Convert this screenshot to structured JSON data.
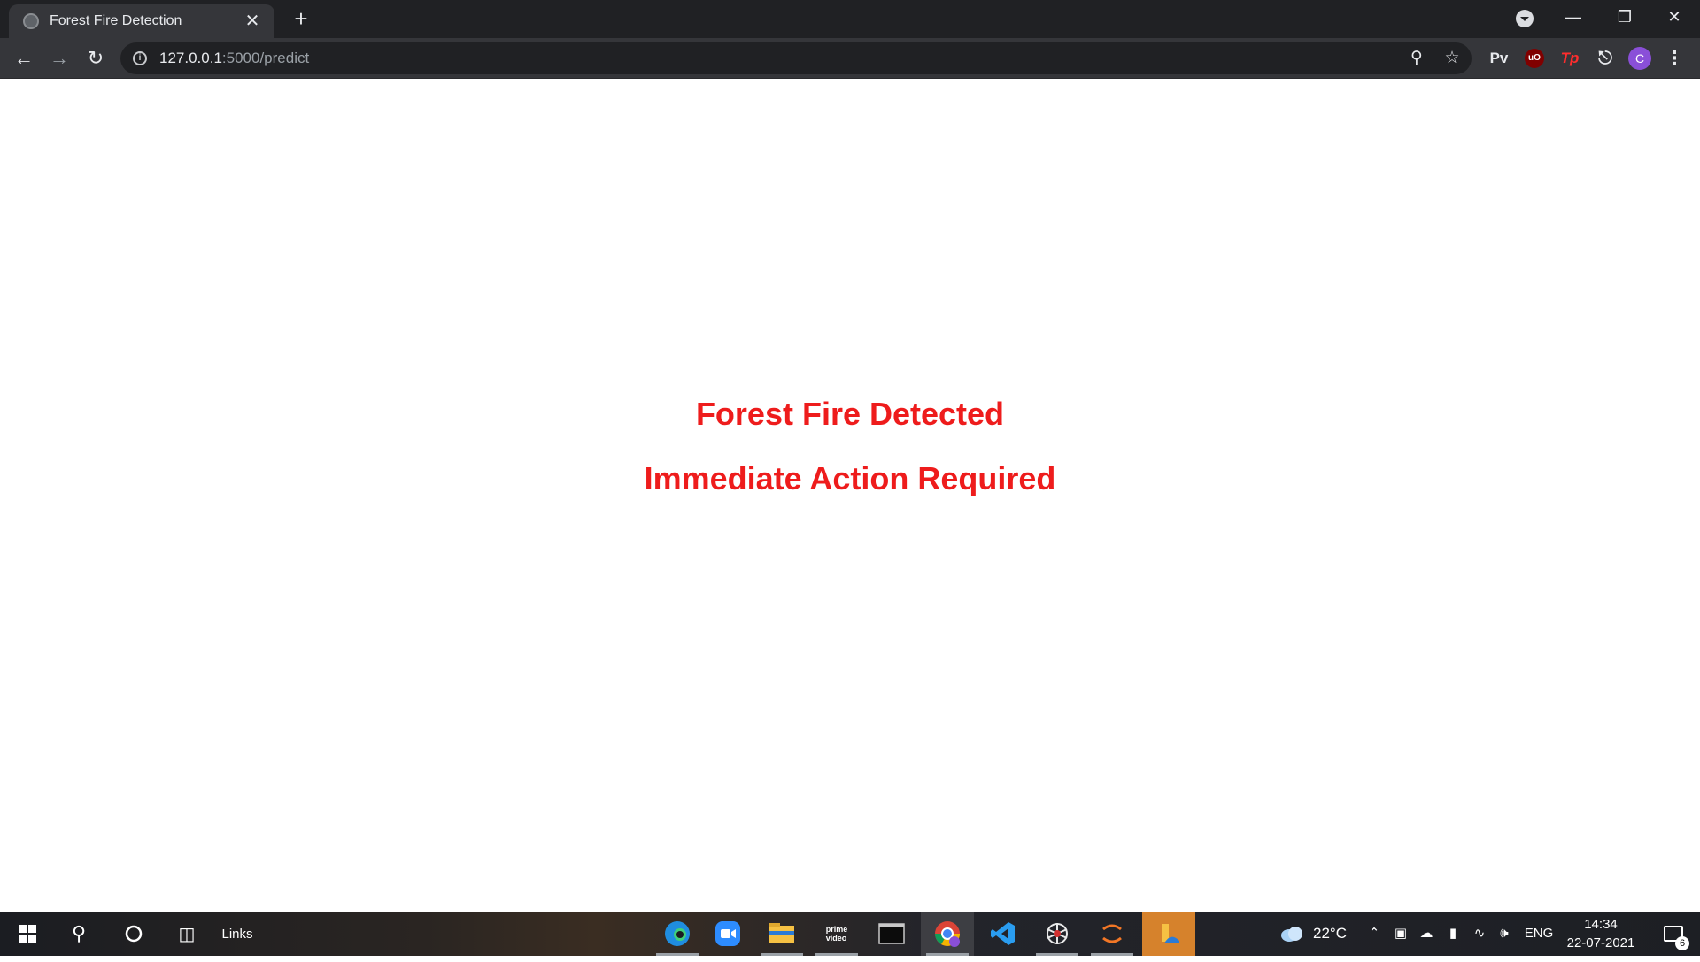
{
  "browser": {
    "tab_title": "Forest Fire Detection",
    "tab_close": "✕",
    "new_tab": "+",
    "url_host": "127.0.0.1",
    "url_path": ":5000/predict",
    "extensions": {
      "pv": "Pv",
      "ublock": "uO",
      "tp": "Tp"
    },
    "avatar_letter": "C"
  },
  "page": {
    "heading1": "Forest Fire Detected",
    "heading2": "Immediate Action Required",
    "text_color": "#ee1c1c"
  },
  "taskbar": {
    "links_label": "Links",
    "weather": "22°C",
    "language": "ENG",
    "time": "14:34",
    "date": "22-07-2021",
    "notifications": "6",
    "apps": [
      "edge-icon",
      "zoom-icon",
      "file-explorer-icon",
      "prime-video-icon",
      "terminal-icon",
      "chrome-icon",
      "vscode-icon",
      "spider-icon",
      "jupyter-icon",
      "sticky-app-icon"
    ]
  }
}
